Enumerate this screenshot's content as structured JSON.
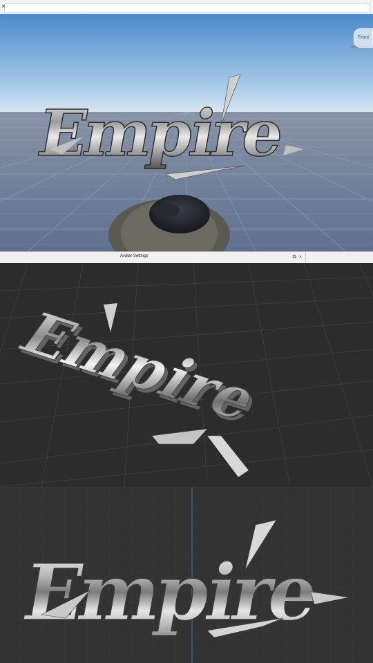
{
  "top_bar": {
    "close_icon": "close-icon"
  },
  "viewport_top": {
    "view_cube_label": "Front",
    "logo_text": "Empire",
    "scene": "sky-and-grid-baseplate"
  },
  "avatar_settings": {
    "title": "Avatar Settings",
    "undock_icon": "undock-icon",
    "close_icon": "close-icon"
  },
  "viewport_mid": {
    "logo_text": "Empire",
    "scene": "dark-3d-grid-perspective"
  },
  "viewport_bottom": {
    "logo_text": "Empire",
    "scene": "dark-grid-front-orthographic"
  },
  "colors": {
    "sky_top": "#4f8fd0",
    "sky_horizon": "#cfe2f1",
    "baseplate": "#6f7f98",
    "dark_viewport": "#2d2d2d",
    "chrome_light": "#dcdcdc",
    "chrome_dark": "#5e5e5e"
  }
}
